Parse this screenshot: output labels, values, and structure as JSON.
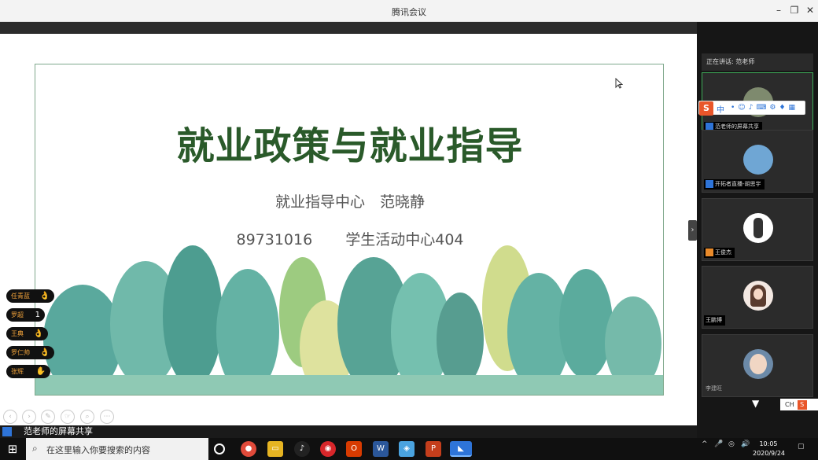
{
  "window": {
    "title": "腾讯会议"
  },
  "slide": {
    "title": "就业政策与就业指导",
    "subtitle": "就业指导中心　范晓静",
    "phone": "89731016",
    "room": "学生活动中心404"
  },
  "tags": [
    {
      "name": "任青蓝",
      "icon": "ok"
    },
    {
      "name": "罗超",
      "icon": "1"
    },
    {
      "name": "王典",
      "icon": "ok"
    },
    {
      "name": "罗仁帅",
      "icon": "ok"
    },
    {
      "name": "张辉",
      "icon": "hand"
    }
  ],
  "share_status": "范老师的屏幕共享",
  "panel": {
    "speaking": "正在讲话: 范老师",
    "participants": [
      {
        "name": "范老师的屏幕共享"
      },
      {
        "name": "开拓者直播-胡思宇"
      },
      {
        "name": "王俊杰"
      },
      {
        "name": "王鹏博"
      },
      {
        "name": "李建旺"
      }
    ],
    "ime_mode": "中",
    "lang": "CH"
  },
  "taskbar": {
    "search_placeholder": "在这里输入你要搜索的内容",
    "time": "10:05",
    "date": "2020/9/24"
  },
  "colors": {
    "slide_title": "#2a5a2a",
    "panel_bg": "#161616",
    "active_border": "#3fae5a",
    "sogou": "#e9562a"
  }
}
